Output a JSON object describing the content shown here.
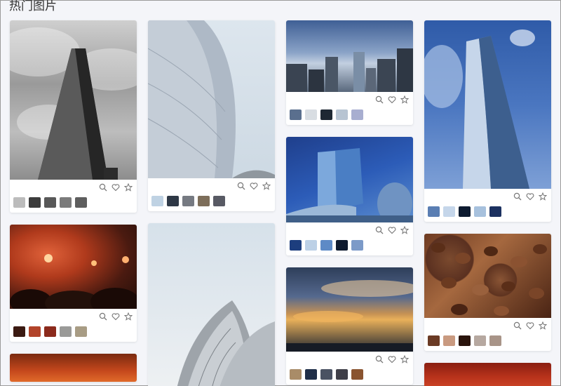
{
  "page_title": "热门图片",
  "icons": {
    "zoom": "zoom-in-icon",
    "like": "heart-icon",
    "favorite": "star-icon"
  },
  "cards": {
    "c1": {
      "photo": "skyscraper-shard-photo",
      "swatches": [
        "#bcbcbc",
        "#3c3c3c",
        "#585858",
        "#7b7b7b",
        "#5e5e5e"
      ]
    },
    "c2": {
      "photo": "torch-crowd-photo",
      "swatches": [
        "#3b1a12",
        "#b2442a",
        "#8b2a1c",
        "#9a9a98",
        "#a89c84"
      ]
    },
    "c4": {
      "photo": "curved-facade-photo",
      "swatches": [
        "#bfd2e3",
        "#2e3846",
        "#767a82",
        "#7d6e5a",
        "#585a64"
      ]
    },
    "c6": {
      "photo": "city-skyline-photo",
      "swatches": [
        "#5a6f8e",
        "#d8dde2",
        "#1e2833",
        "#b7c4d2",
        "#a8aed0"
      ]
    },
    "c7": {
      "photo": "glass-building-photo",
      "swatches": [
        "#1d3e7e",
        "#bcd0e6",
        "#5d8ac6",
        "#0e1a2e",
        "#7c9ac8"
      ]
    },
    "c8": {
      "photo": "sunset-sky-photo",
      "swatches": [
        "#a98c68",
        "#1f2e48",
        "#4a5262",
        "#3f3f48",
        "#8a5430"
      ]
    },
    "c9": {
      "photo": "tall-tower-photo",
      "swatches": [
        "#5a7eb3",
        "#c5d6ea",
        "#0d1b30",
        "#a7c1dd",
        "#1c3160"
      ]
    },
    "c10": {
      "photo": "coffee-beans-photo",
      "swatches": [
        "#6a3a24",
        "#c99a80",
        "#2a140c",
        "#b6a8a0",
        "#a89488"
      ]
    }
  }
}
